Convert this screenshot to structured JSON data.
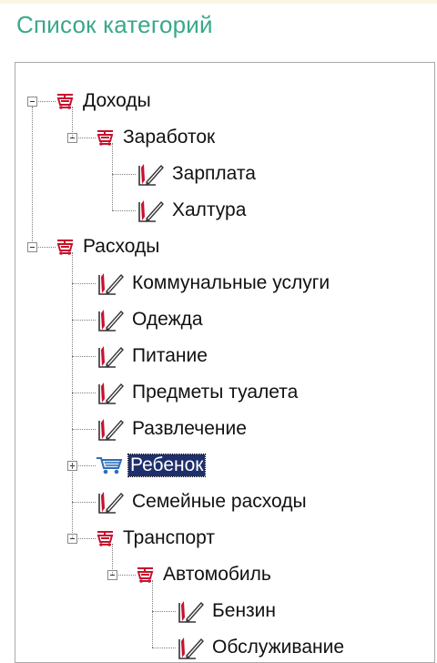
{
  "title": "Список категорий",
  "colors": {
    "title": "#39a889",
    "selected_bg": "#1f2f6b",
    "folder_icon": "#c8102e",
    "cart_icon": "#2f6fb8"
  },
  "tree": {
    "nodes": [
      {
        "label": "Доходы",
        "icon": "folder-cart-icon",
        "expanded": true
      },
      {
        "label": "Заработок",
        "icon": "folder-cart-icon",
        "expanded": true
      },
      {
        "label": "Зарплата",
        "icon": "edit-document-icon"
      },
      {
        "label": "Халтура",
        "icon": "edit-document-icon"
      },
      {
        "label": "Расходы",
        "icon": "folder-cart-icon",
        "expanded": true
      },
      {
        "label": "Коммунальные услуги",
        "icon": "edit-document-icon"
      },
      {
        "label": "Одежда",
        "icon": "edit-document-icon"
      },
      {
        "label": "Питание",
        "icon": "edit-document-icon"
      },
      {
        "label": "Предметы туалета",
        "icon": "edit-document-icon"
      },
      {
        "label": "Развлечение",
        "icon": "edit-document-icon"
      },
      {
        "label": "Ребенок",
        "icon": "shopping-cart-icon",
        "expanded": false,
        "selected": true
      },
      {
        "label": "Семейные расходы",
        "icon": "edit-document-icon"
      },
      {
        "label": "Транспорт",
        "icon": "folder-cart-icon",
        "expanded": true
      },
      {
        "label": "Автомобиль",
        "icon": "folder-cart-icon",
        "expanded": true
      },
      {
        "label": "Бензин",
        "icon": "edit-document-icon"
      },
      {
        "label": "Обслуживание",
        "icon": "edit-document-icon"
      }
    ]
  }
}
